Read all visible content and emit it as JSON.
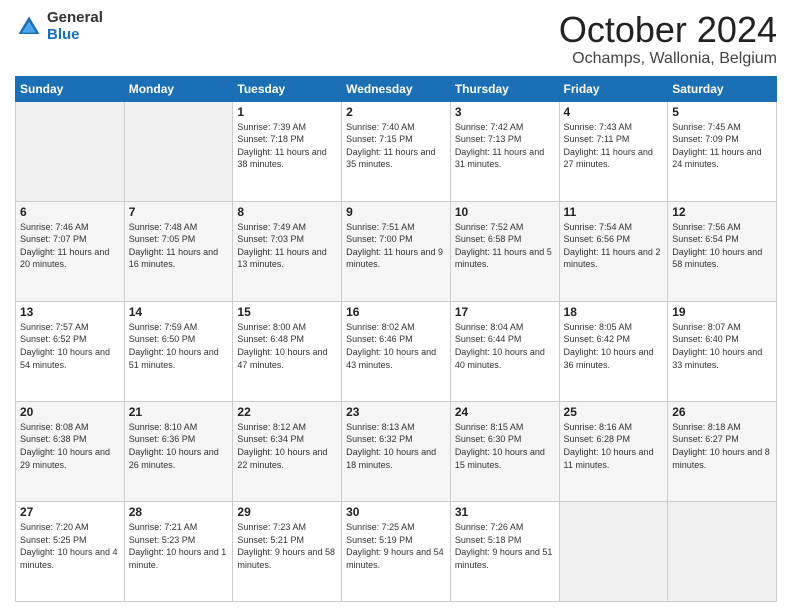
{
  "logo": {
    "general": "General",
    "blue": "Blue"
  },
  "title": {
    "month_year": "October 2024",
    "location": "Ochamps, Wallonia, Belgium"
  },
  "days_of_week": [
    "Sunday",
    "Monday",
    "Tuesday",
    "Wednesday",
    "Thursday",
    "Friday",
    "Saturday"
  ],
  "weeks": [
    [
      {
        "day": "",
        "sunrise": "",
        "sunset": "",
        "daylight": "",
        "empty": true
      },
      {
        "day": "",
        "sunrise": "",
        "sunset": "",
        "daylight": "",
        "empty": true
      },
      {
        "day": "1",
        "sunrise": "Sunrise: 7:39 AM",
        "sunset": "Sunset: 7:18 PM",
        "daylight": "Daylight: 11 hours and 38 minutes."
      },
      {
        "day": "2",
        "sunrise": "Sunrise: 7:40 AM",
        "sunset": "Sunset: 7:15 PM",
        "daylight": "Daylight: 11 hours and 35 minutes."
      },
      {
        "day": "3",
        "sunrise": "Sunrise: 7:42 AM",
        "sunset": "Sunset: 7:13 PM",
        "daylight": "Daylight: 11 hours and 31 minutes."
      },
      {
        "day": "4",
        "sunrise": "Sunrise: 7:43 AM",
        "sunset": "Sunset: 7:11 PM",
        "daylight": "Daylight: 11 hours and 27 minutes."
      },
      {
        "day": "5",
        "sunrise": "Sunrise: 7:45 AM",
        "sunset": "Sunset: 7:09 PM",
        "daylight": "Daylight: 11 hours and 24 minutes."
      }
    ],
    [
      {
        "day": "6",
        "sunrise": "Sunrise: 7:46 AM",
        "sunset": "Sunset: 7:07 PM",
        "daylight": "Daylight: 11 hours and 20 minutes."
      },
      {
        "day": "7",
        "sunrise": "Sunrise: 7:48 AM",
        "sunset": "Sunset: 7:05 PM",
        "daylight": "Daylight: 11 hours and 16 minutes."
      },
      {
        "day": "8",
        "sunrise": "Sunrise: 7:49 AM",
        "sunset": "Sunset: 7:03 PM",
        "daylight": "Daylight: 11 hours and 13 minutes."
      },
      {
        "day": "9",
        "sunrise": "Sunrise: 7:51 AM",
        "sunset": "Sunset: 7:00 PM",
        "daylight": "Daylight: 11 hours and 9 minutes."
      },
      {
        "day": "10",
        "sunrise": "Sunrise: 7:52 AM",
        "sunset": "Sunset: 6:58 PM",
        "daylight": "Daylight: 11 hours and 5 minutes."
      },
      {
        "day": "11",
        "sunrise": "Sunrise: 7:54 AM",
        "sunset": "Sunset: 6:56 PM",
        "daylight": "Daylight: 11 hours and 2 minutes."
      },
      {
        "day": "12",
        "sunrise": "Sunrise: 7:56 AM",
        "sunset": "Sunset: 6:54 PM",
        "daylight": "Daylight: 10 hours and 58 minutes."
      }
    ],
    [
      {
        "day": "13",
        "sunrise": "Sunrise: 7:57 AM",
        "sunset": "Sunset: 6:52 PM",
        "daylight": "Daylight: 10 hours and 54 minutes."
      },
      {
        "day": "14",
        "sunrise": "Sunrise: 7:59 AM",
        "sunset": "Sunset: 6:50 PM",
        "daylight": "Daylight: 10 hours and 51 minutes."
      },
      {
        "day": "15",
        "sunrise": "Sunrise: 8:00 AM",
        "sunset": "Sunset: 6:48 PM",
        "daylight": "Daylight: 10 hours and 47 minutes."
      },
      {
        "day": "16",
        "sunrise": "Sunrise: 8:02 AM",
        "sunset": "Sunset: 6:46 PM",
        "daylight": "Daylight: 10 hours and 43 minutes."
      },
      {
        "day": "17",
        "sunrise": "Sunrise: 8:04 AM",
        "sunset": "Sunset: 6:44 PM",
        "daylight": "Daylight: 10 hours and 40 minutes."
      },
      {
        "day": "18",
        "sunrise": "Sunrise: 8:05 AM",
        "sunset": "Sunset: 6:42 PM",
        "daylight": "Daylight: 10 hours and 36 minutes."
      },
      {
        "day": "19",
        "sunrise": "Sunrise: 8:07 AM",
        "sunset": "Sunset: 6:40 PM",
        "daylight": "Daylight: 10 hours and 33 minutes."
      }
    ],
    [
      {
        "day": "20",
        "sunrise": "Sunrise: 8:08 AM",
        "sunset": "Sunset: 6:38 PM",
        "daylight": "Daylight: 10 hours and 29 minutes."
      },
      {
        "day": "21",
        "sunrise": "Sunrise: 8:10 AM",
        "sunset": "Sunset: 6:36 PM",
        "daylight": "Daylight: 10 hours and 26 minutes."
      },
      {
        "day": "22",
        "sunrise": "Sunrise: 8:12 AM",
        "sunset": "Sunset: 6:34 PM",
        "daylight": "Daylight: 10 hours and 22 minutes."
      },
      {
        "day": "23",
        "sunrise": "Sunrise: 8:13 AM",
        "sunset": "Sunset: 6:32 PM",
        "daylight": "Daylight: 10 hours and 18 minutes."
      },
      {
        "day": "24",
        "sunrise": "Sunrise: 8:15 AM",
        "sunset": "Sunset: 6:30 PM",
        "daylight": "Daylight: 10 hours and 15 minutes."
      },
      {
        "day": "25",
        "sunrise": "Sunrise: 8:16 AM",
        "sunset": "Sunset: 6:28 PM",
        "daylight": "Daylight: 10 hours and 11 minutes."
      },
      {
        "day": "26",
        "sunrise": "Sunrise: 8:18 AM",
        "sunset": "Sunset: 6:27 PM",
        "daylight": "Daylight: 10 hours and 8 minutes."
      }
    ],
    [
      {
        "day": "27",
        "sunrise": "Sunrise: 7:20 AM",
        "sunset": "Sunset: 5:25 PM",
        "daylight": "Daylight: 10 hours and 4 minutes."
      },
      {
        "day": "28",
        "sunrise": "Sunrise: 7:21 AM",
        "sunset": "Sunset: 5:23 PM",
        "daylight": "Daylight: 10 hours and 1 minute."
      },
      {
        "day": "29",
        "sunrise": "Sunrise: 7:23 AM",
        "sunset": "Sunset: 5:21 PM",
        "daylight": "Daylight: 9 hours and 58 minutes."
      },
      {
        "day": "30",
        "sunrise": "Sunrise: 7:25 AM",
        "sunset": "Sunset: 5:19 PM",
        "daylight": "Daylight: 9 hours and 54 minutes."
      },
      {
        "day": "31",
        "sunrise": "Sunrise: 7:26 AM",
        "sunset": "Sunset: 5:18 PM",
        "daylight": "Daylight: 9 hours and 51 minutes."
      },
      {
        "day": "",
        "sunrise": "",
        "sunset": "",
        "daylight": "",
        "empty": true
      },
      {
        "day": "",
        "sunrise": "",
        "sunset": "",
        "daylight": "",
        "empty": true
      }
    ]
  ]
}
